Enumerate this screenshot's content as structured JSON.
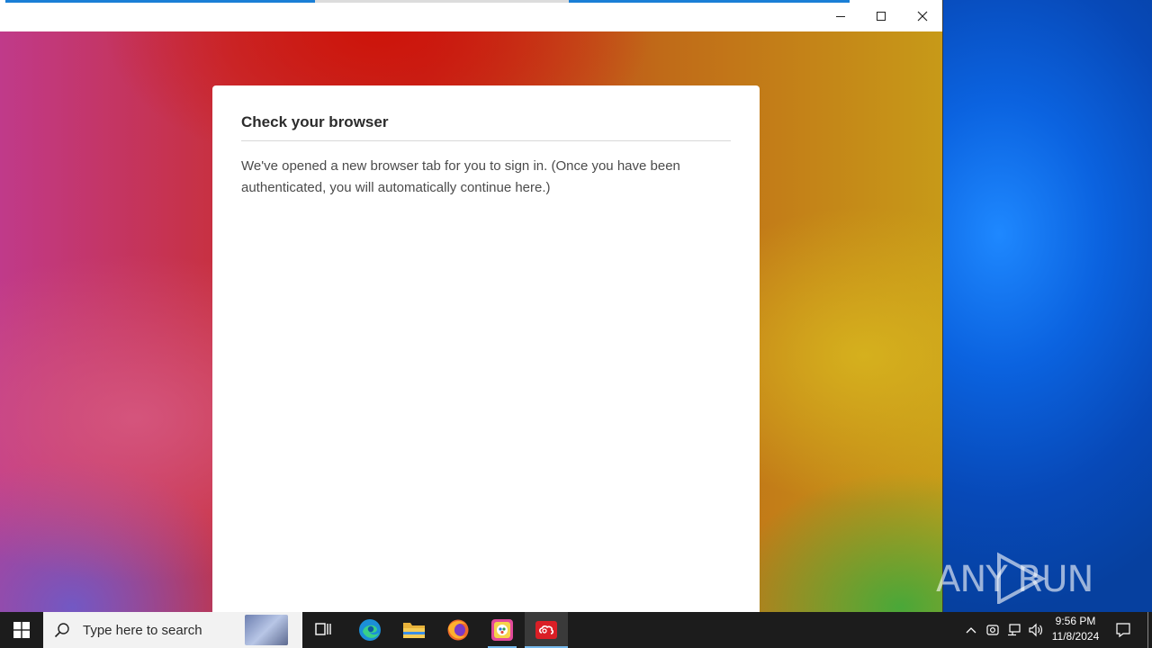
{
  "window": {
    "minimize_label": "Minimize",
    "maximize_label": "Maximize",
    "close_label": "Close",
    "loading_progress": 0.55
  },
  "dialog": {
    "title": "Check your browser",
    "body": "We've opened a new browser tab for you to sign in. (Once you have been authenticated, you will automatically continue here.)"
  },
  "watermark": {
    "text": "ANY RUN"
  },
  "taskbar": {
    "search_placeholder": "Type here to search",
    "apps": [
      {
        "name": "edge-icon"
      },
      {
        "name": "file-explorer-icon"
      },
      {
        "name": "firefox-icon"
      },
      {
        "name": "paint-icon"
      },
      {
        "name": "creative-cloud-icon",
        "active": true
      }
    ],
    "clock": {
      "time": "9:56 PM",
      "date": "11/8/2024"
    }
  },
  "colors": {
    "taskbar_bg": "#1c1c1c",
    "desktop_blue": "#0b63e0",
    "accent_progress": "#1a7fd6"
  }
}
